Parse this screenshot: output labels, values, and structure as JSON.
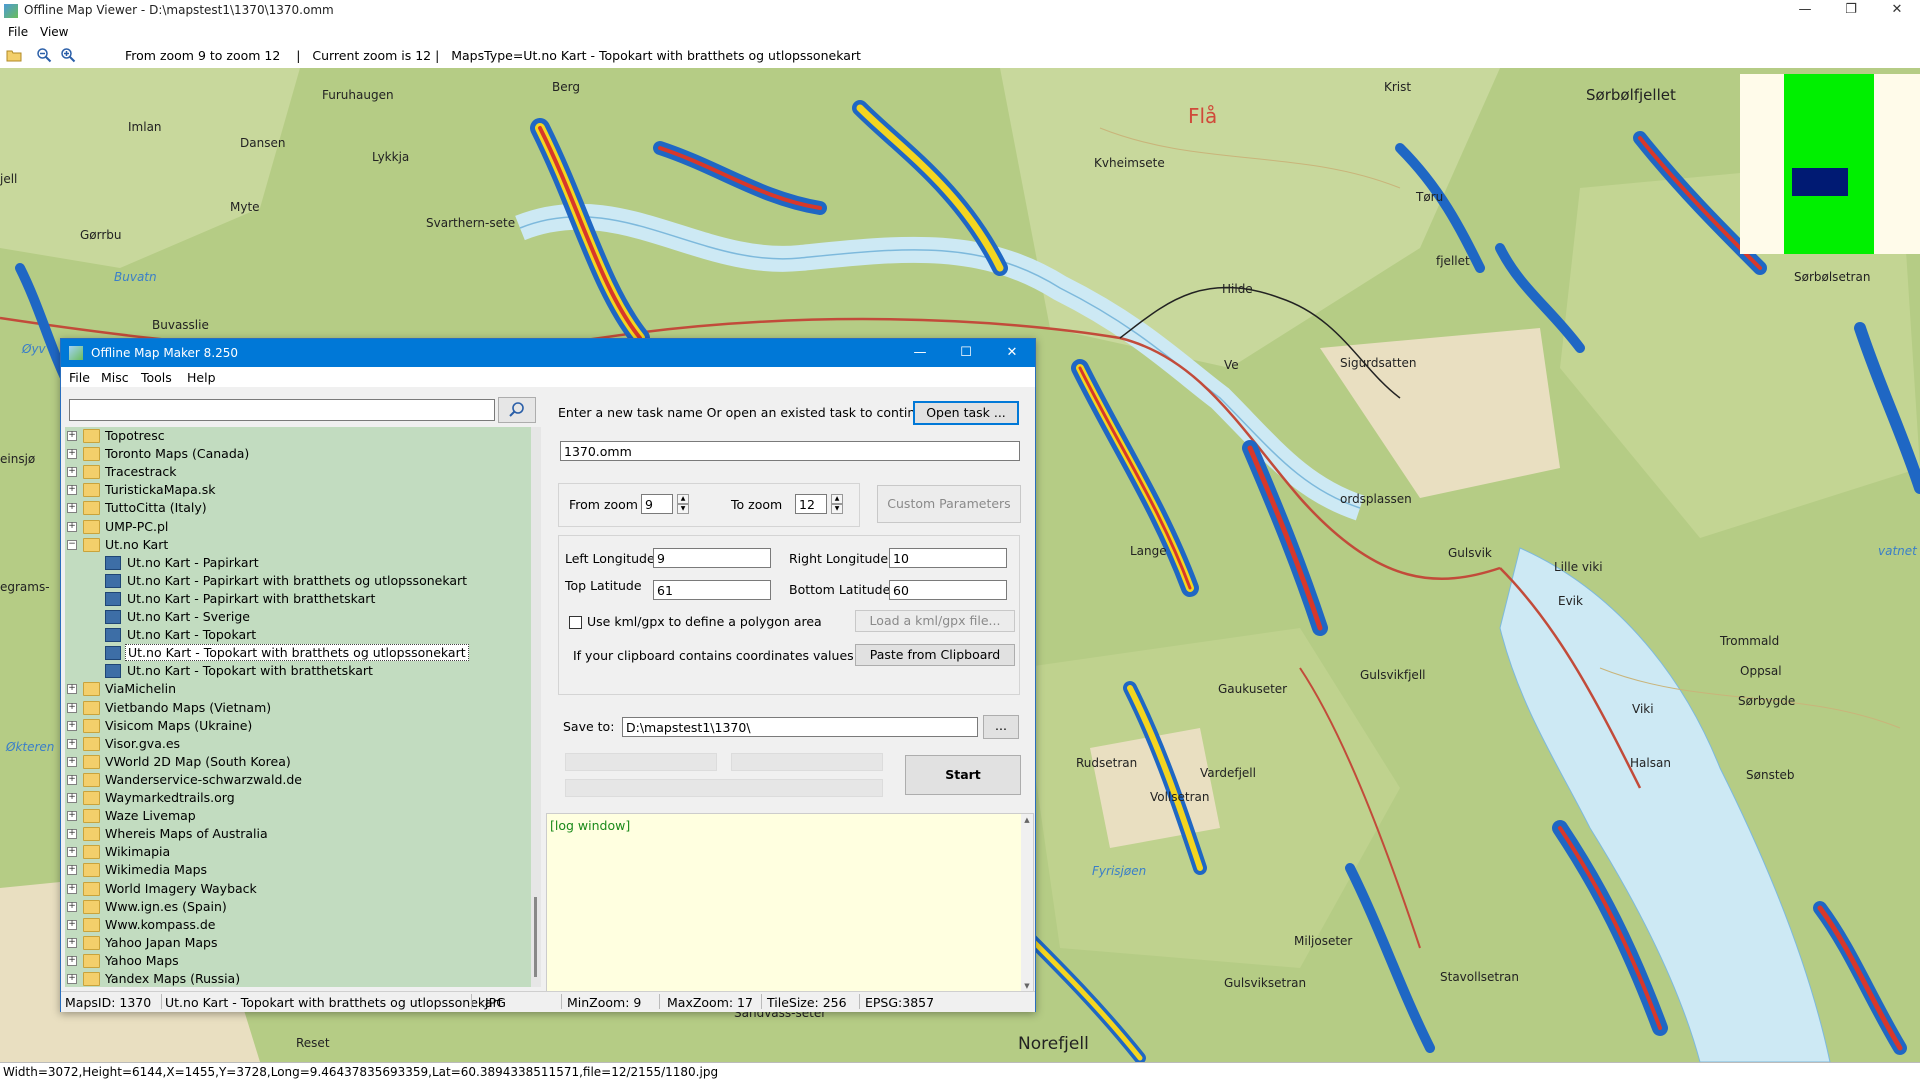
{
  "viewer": {
    "title": "Offline Map Viewer - D:\\mapstest1\\1370\\1370.omm",
    "menu": [
      "File",
      "View"
    ],
    "toolbar_status": "From zoom 9 to zoom 12    |   Current zoom is 12 |   MapsType=Ut.no Kart - Topokart with bratthets og utlopssonekart",
    "status_bar": "Width=3072,Height=6144,X=1455,Y=3728,Long=9.46437835693359,Lat=60.3894338511571,file=12/2155/1180.jpg",
    "icons": [
      "open-folder-icon",
      "zoom-out-icon",
      "zoom-in-icon"
    ]
  },
  "map_labels": [
    {
      "text": "Berg"
    },
    {
      "text": "Furuhaugen"
    },
    {
      "text": "Imlan"
    },
    {
      "text": "Dansen"
    },
    {
      "text": "Lykkja"
    },
    {
      "text": "Myte"
    },
    {
      "text": "Gørrbu"
    },
    {
      "text": "Buvatn"
    },
    {
      "text": "Buvasslie"
    },
    {
      "text": "Svarthern-sete"
    },
    {
      "text": "Flå"
    },
    {
      "text": "Krist"
    },
    {
      "text": "Sørbølfjellet"
    },
    {
      "text": "Kvheimsete"
    },
    {
      "text": "Tøru"
    },
    {
      "text": "fjellet"
    },
    {
      "text": "Hilde"
    },
    {
      "text": "Sørbølsetran"
    },
    {
      "text": "Ve"
    },
    {
      "text": "Sigurdsatten"
    },
    {
      "text": "ordsplassen"
    },
    {
      "text": "Gulsvik"
    },
    {
      "text": "Lille viki"
    },
    {
      "text": "Evik"
    },
    {
      "text": "Trommald"
    },
    {
      "text": "Oppsal"
    },
    {
      "text": "Sørbygde"
    },
    {
      "text": "Viki"
    },
    {
      "text": "Halsan"
    },
    {
      "text": "Sønsteb"
    },
    {
      "text": "Rudsetran"
    },
    {
      "text": "Vollsetran"
    },
    {
      "text": "Fyrisjøen"
    },
    {
      "text": "Miljoseter"
    },
    {
      "text": "Gulsviksetran"
    },
    {
      "text": "Sandvass-seter"
    },
    {
      "text": "Norefjell"
    },
    {
      "text": "Reset"
    },
    {
      "text": "Vardefjell"
    },
    {
      "text": "Lange"
    },
    {
      "text": "Gaukuseter"
    },
    {
      "text": "Gulsvikfjell"
    },
    {
      "text": "Stavollsetran"
    },
    {
      "text": "egrams-"
    },
    {
      "text": "Økteren"
    },
    {
      "text": "Øyv"
    },
    {
      "text": "einsjø"
    },
    {
      "text": "jell"
    },
    {
      "text": "vatnet"
    }
  ],
  "maker": {
    "title": "Offline Map Maker 8.250",
    "menu": [
      "File",
      "Misc",
      "Tools",
      "Help"
    ],
    "search": {
      "value": ""
    },
    "tree": [
      {
        "label": "Topotresc",
        "type": "folder",
        "level": 0,
        "expander": "+"
      },
      {
        "label": "Toronto Maps (Canada)",
        "type": "folder",
        "level": 0,
        "expander": "+"
      },
      {
        "label": "Tracestrack",
        "type": "folder",
        "level": 0,
        "expander": "+"
      },
      {
        "label": "TuristickaMapa.sk",
        "type": "folder",
        "level": 0,
        "expander": "+"
      },
      {
        "label": "TuttoCitta (Italy)",
        "type": "folder",
        "level": 0,
        "expander": "+"
      },
      {
        "label": "UMP-PC.pl",
        "type": "folder",
        "level": 0,
        "expander": "+"
      },
      {
        "label": "Ut.no Kart",
        "type": "folder-open",
        "level": 0,
        "expander": "−"
      },
      {
        "label": "Ut.no Kart - Papirkart",
        "type": "map",
        "level": 1,
        "expander": ""
      },
      {
        "label": "Ut.no Kart - Papirkart with bratthets og utlopssonekart",
        "type": "map",
        "level": 1,
        "expander": ""
      },
      {
        "label": "Ut.no Kart - Papirkart with bratthetskart",
        "type": "map",
        "level": 1,
        "expander": ""
      },
      {
        "label": "Ut.no Kart - Sverige",
        "type": "map",
        "level": 1,
        "expander": ""
      },
      {
        "label": "Ut.no Kart - Topokart",
        "type": "map",
        "level": 1,
        "expander": ""
      },
      {
        "label": "Ut.no Kart - Topokart with bratthets og utlopssonekart",
        "type": "map",
        "level": 1,
        "expander": "",
        "selected": true
      },
      {
        "label": "Ut.no Kart - Topokart with bratthetskart",
        "type": "map",
        "level": 1,
        "expander": ""
      },
      {
        "label": "ViaMichelin",
        "type": "folder",
        "level": 0,
        "expander": "+"
      },
      {
        "label": "Vietbando Maps (Vietnam)",
        "type": "folder",
        "level": 0,
        "expander": "+"
      },
      {
        "label": "Visicom Maps (Ukraine)",
        "type": "folder",
        "level": 0,
        "expander": "+"
      },
      {
        "label": "Visor.gva.es",
        "type": "folder",
        "level": 0,
        "expander": "+"
      },
      {
        "label": "VWorld 2D Map (South Korea)",
        "type": "folder",
        "level": 0,
        "expander": "+"
      },
      {
        "label": "Wanderservice-schwarzwald.de",
        "type": "folder",
        "level": 0,
        "expander": "+"
      },
      {
        "label": "Waymarkedtrails.org",
        "type": "folder",
        "level": 0,
        "expander": "+"
      },
      {
        "label": "Waze Livemap",
        "type": "folder",
        "level": 0,
        "expander": "+"
      },
      {
        "label": "Whereis Maps of Australia",
        "type": "folder",
        "level": 0,
        "expander": "+"
      },
      {
        "label": "Wikimapia",
        "type": "folder",
        "level": 0,
        "expander": "+"
      },
      {
        "label": "Wikimedia Maps",
        "type": "folder",
        "level": 0,
        "expander": "+"
      },
      {
        "label": "World Imagery Wayback",
        "type": "folder",
        "level": 0,
        "expander": "+"
      },
      {
        "label": "Www.ign.es (Spain)",
        "type": "folder",
        "level": 0,
        "expander": "+"
      },
      {
        "label": "Www.kompass.de",
        "type": "folder",
        "level": 0,
        "expander": "+"
      },
      {
        "label": "Yahoo Japan Maps",
        "type": "folder",
        "level": 0,
        "expander": "+"
      },
      {
        "label": "Yahoo Maps",
        "type": "folder",
        "level": 0,
        "expander": "+"
      },
      {
        "label": "Yandex Maps (Russia)",
        "type": "folder",
        "level": 0,
        "expander": "+"
      }
    ],
    "task_prompt": "Enter a new task name Or open an existed task to continue:",
    "open_task_label": "Open task ...",
    "task_name": "1370.omm",
    "from_zoom_label": "From zoom",
    "from_zoom_value": "9",
    "to_zoom_label": "To zoom",
    "to_zoom_value": "12",
    "custom_params_label": "Custom Parameters",
    "left_lon_label": "Left Longitude",
    "left_lon_value": "9",
    "right_lon_label": "Right Longitude",
    "right_lon_value": "10",
    "top_lat_label": "Top Latitude",
    "top_lat_value": "61",
    "bottom_lat_label": "Bottom Latitude",
    "bottom_lat_value": "60",
    "kml_checkbox_label": "Use kml/gpx to define a polygon area",
    "kml_checked": false,
    "load_kml_label": "Load a kml/gpx file...",
    "clipboard_prompt": "If your clipboard contains coordinates values:",
    "paste_label": "Paste from Clipboard",
    "save_to_label": "Save to:",
    "save_to_value": "D:\\mapstest1\\1370\\",
    "browse_label": "...",
    "start_label": "Start",
    "log_text": "[log window]",
    "status": {
      "maps_id": "MapsID: 1370",
      "map_name": "Ut.no Kart - Topokart with bratthets og utlopssonekart",
      "format": "JPG",
      "min_zoom": "MinZoom: 9",
      "max_zoom": "MaxZoom: 17",
      "tile_size": "TileSize: 256",
      "epsg": "EPSG:3857"
    }
  },
  "colors": {
    "title_bar_active": "#0078d7",
    "tree_bg": "#c2dcc0",
    "log_bg": "#ffffe0",
    "map_base": "#e8e4cf",
    "terrain_green": "#b5cc85",
    "lake": "#cde9f4",
    "steep_red": "#d8382a",
    "steep_yellow": "#f4d520",
    "steep_blue": "#1f67c4"
  }
}
